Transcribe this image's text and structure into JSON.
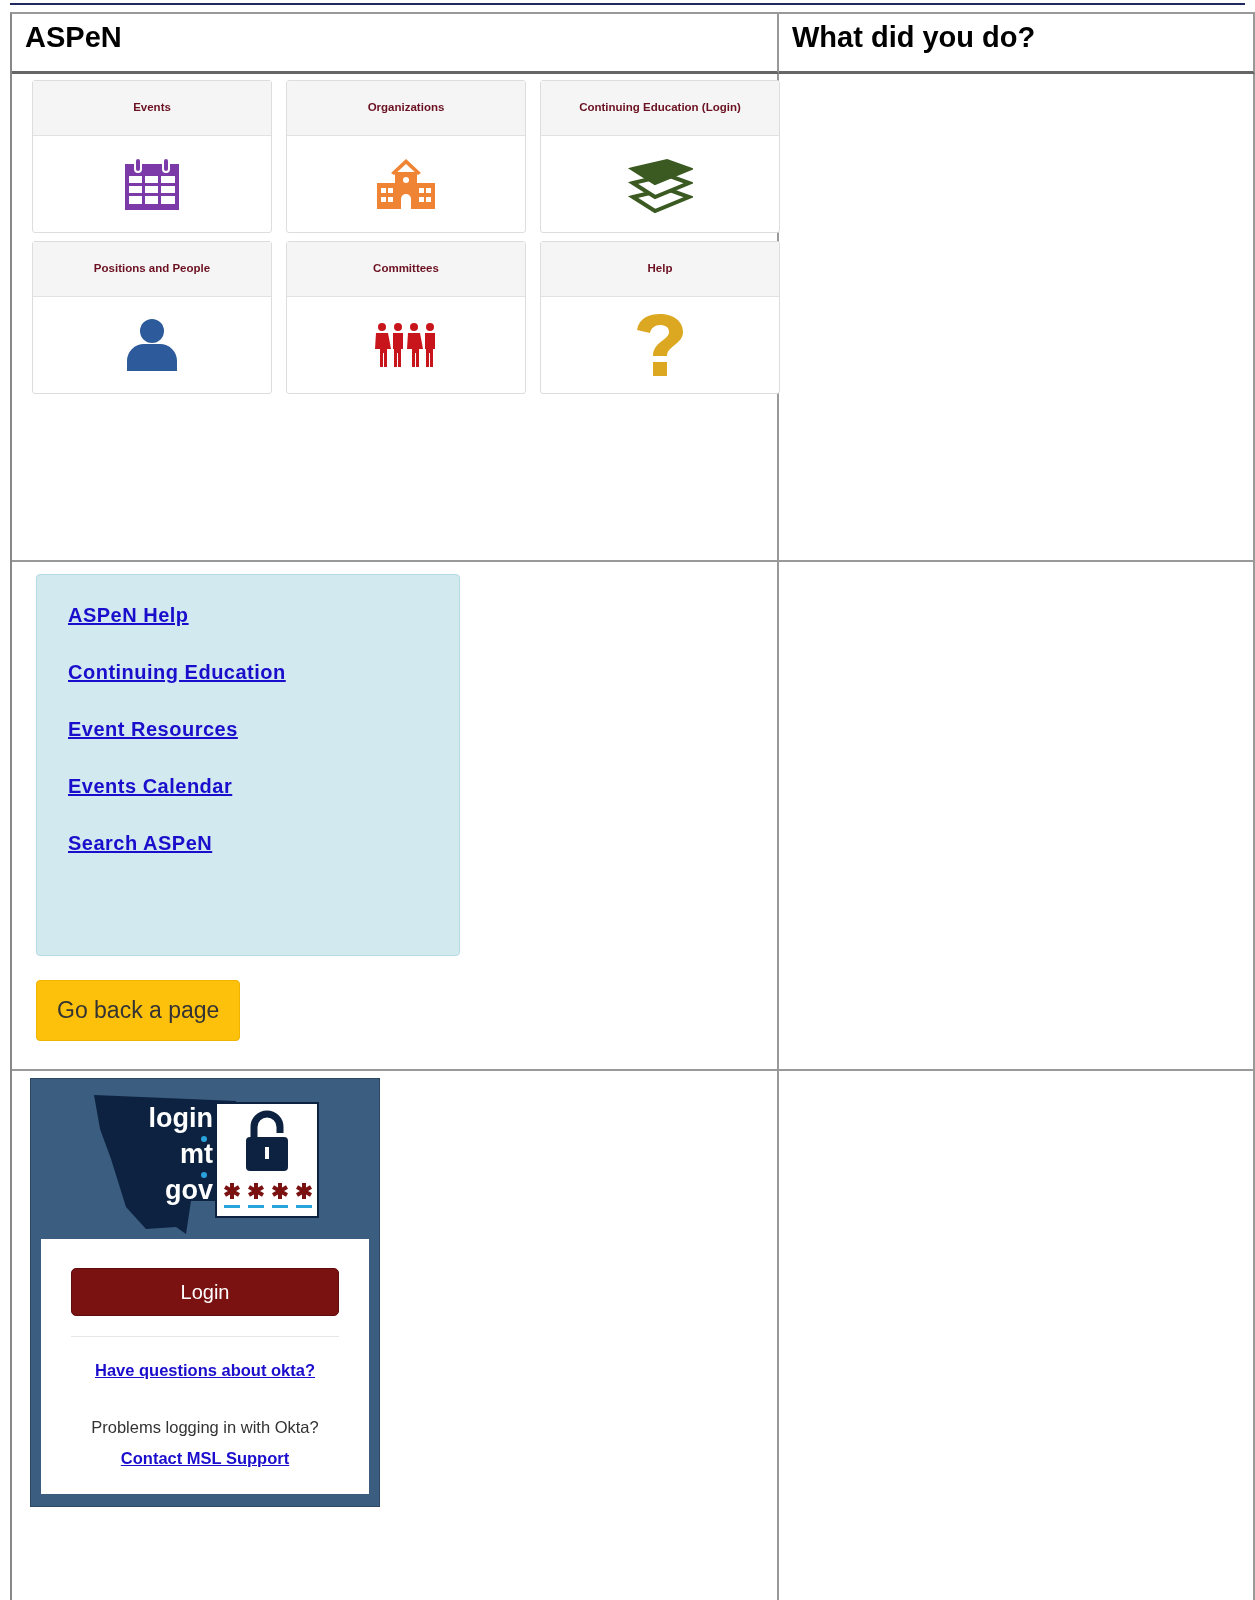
{
  "table": {
    "columns": [
      "ASPeN",
      "What did you do?"
    ],
    "rows": [
      {
        "tiles": [
          {
            "label": "Events"
          },
          {
            "label": "Organizations"
          },
          {
            "label": "Continuing Education (Login)"
          },
          {
            "label": "Positions and People"
          },
          {
            "label": "Committees"
          },
          {
            "label": "Help"
          }
        ]
      },
      {
        "links": [
          "ASPeN Help",
          "Continuing Education",
          "Event Resources",
          "Events Calendar",
          "Search ASPeN"
        ],
        "button": "Go back a page"
      },
      {
        "logo": [
          "login",
          "mt",
          "gov"
        ],
        "login_button": "Login",
        "questions_link": "Have questions about okta?",
        "problem_text": "Problems logging in with Okta?",
        "support_link": "Contact MSL Support"
      }
    ]
  }
}
